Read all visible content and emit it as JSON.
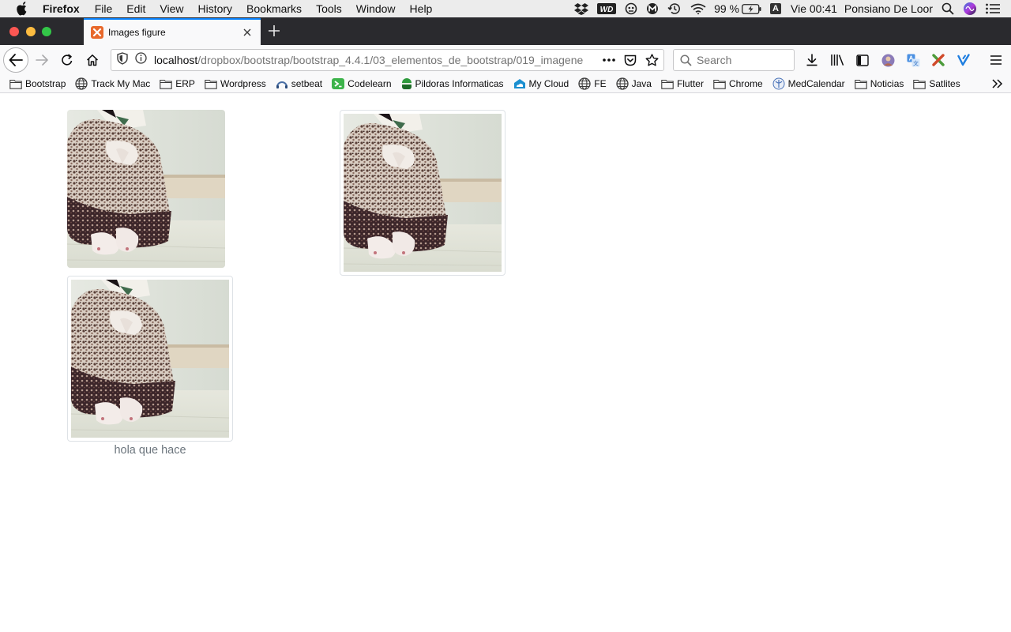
{
  "menubar": {
    "app": "Firefox",
    "items": [
      "File",
      "Edit",
      "View",
      "History",
      "Bookmarks",
      "Tools",
      "Window",
      "Help"
    ],
    "battery": "99 %",
    "input_source": "A",
    "clock": "Vie 00:41",
    "user": "Ponsiano De Loor",
    "status_icons": [
      "dropbox-icon",
      "wd-icon",
      "ghost-icon",
      "m-icon",
      "time-machine-icon",
      "wifi-icon",
      "battery-icon",
      "spotlight-icon",
      "siri-icon",
      "notification-center-icon"
    ]
  },
  "tab": {
    "title": "Images figure",
    "favicon": "xampp-icon"
  },
  "navbar": {
    "url_host": "localhost",
    "url_path": "/dropbox/bootstrap/bootstrap_4.4.1/03_elementos_de_bootstrap/019_imagene",
    "search_placeholder": "Search"
  },
  "bookmarks": [
    {
      "label": "Bootstrap",
      "icon": "folder-icon"
    },
    {
      "label": "Track My Mac",
      "icon": "globe-icon"
    },
    {
      "label": "ERP",
      "icon": "folder-icon"
    },
    {
      "label": "Wordpress",
      "icon": "folder-icon"
    },
    {
      "label": "setbeat",
      "icon": "setbeat-icon"
    },
    {
      "label": "Codelearn",
      "icon": "codelearn-icon"
    },
    {
      "label": "Pildoras Informaticas",
      "icon": "pildoras-icon"
    },
    {
      "label": "My Cloud",
      "icon": "cloud-icon"
    },
    {
      "label": "FE",
      "icon": "globe-icon"
    },
    {
      "label": "Java",
      "icon": "globe-icon"
    },
    {
      "label": "Flutter",
      "icon": "folder-icon"
    },
    {
      "label": "Chrome",
      "icon": "folder-icon"
    },
    {
      "label": "MedCalendar",
      "icon": "medcalendar-icon"
    },
    {
      "label": "Noticias",
      "icon": "folder-icon"
    },
    {
      "label": "Satlites",
      "icon": "folder-icon"
    }
  ],
  "page": {
    "caption": "hola que hace"
  },
  "colors": {
    "accent": "#0a84ff",
    "tab_strip": "#2a2a2e",
    "caption": "#6c757d",
    "thumbnail_border": "#dee2e6"
  }
}
